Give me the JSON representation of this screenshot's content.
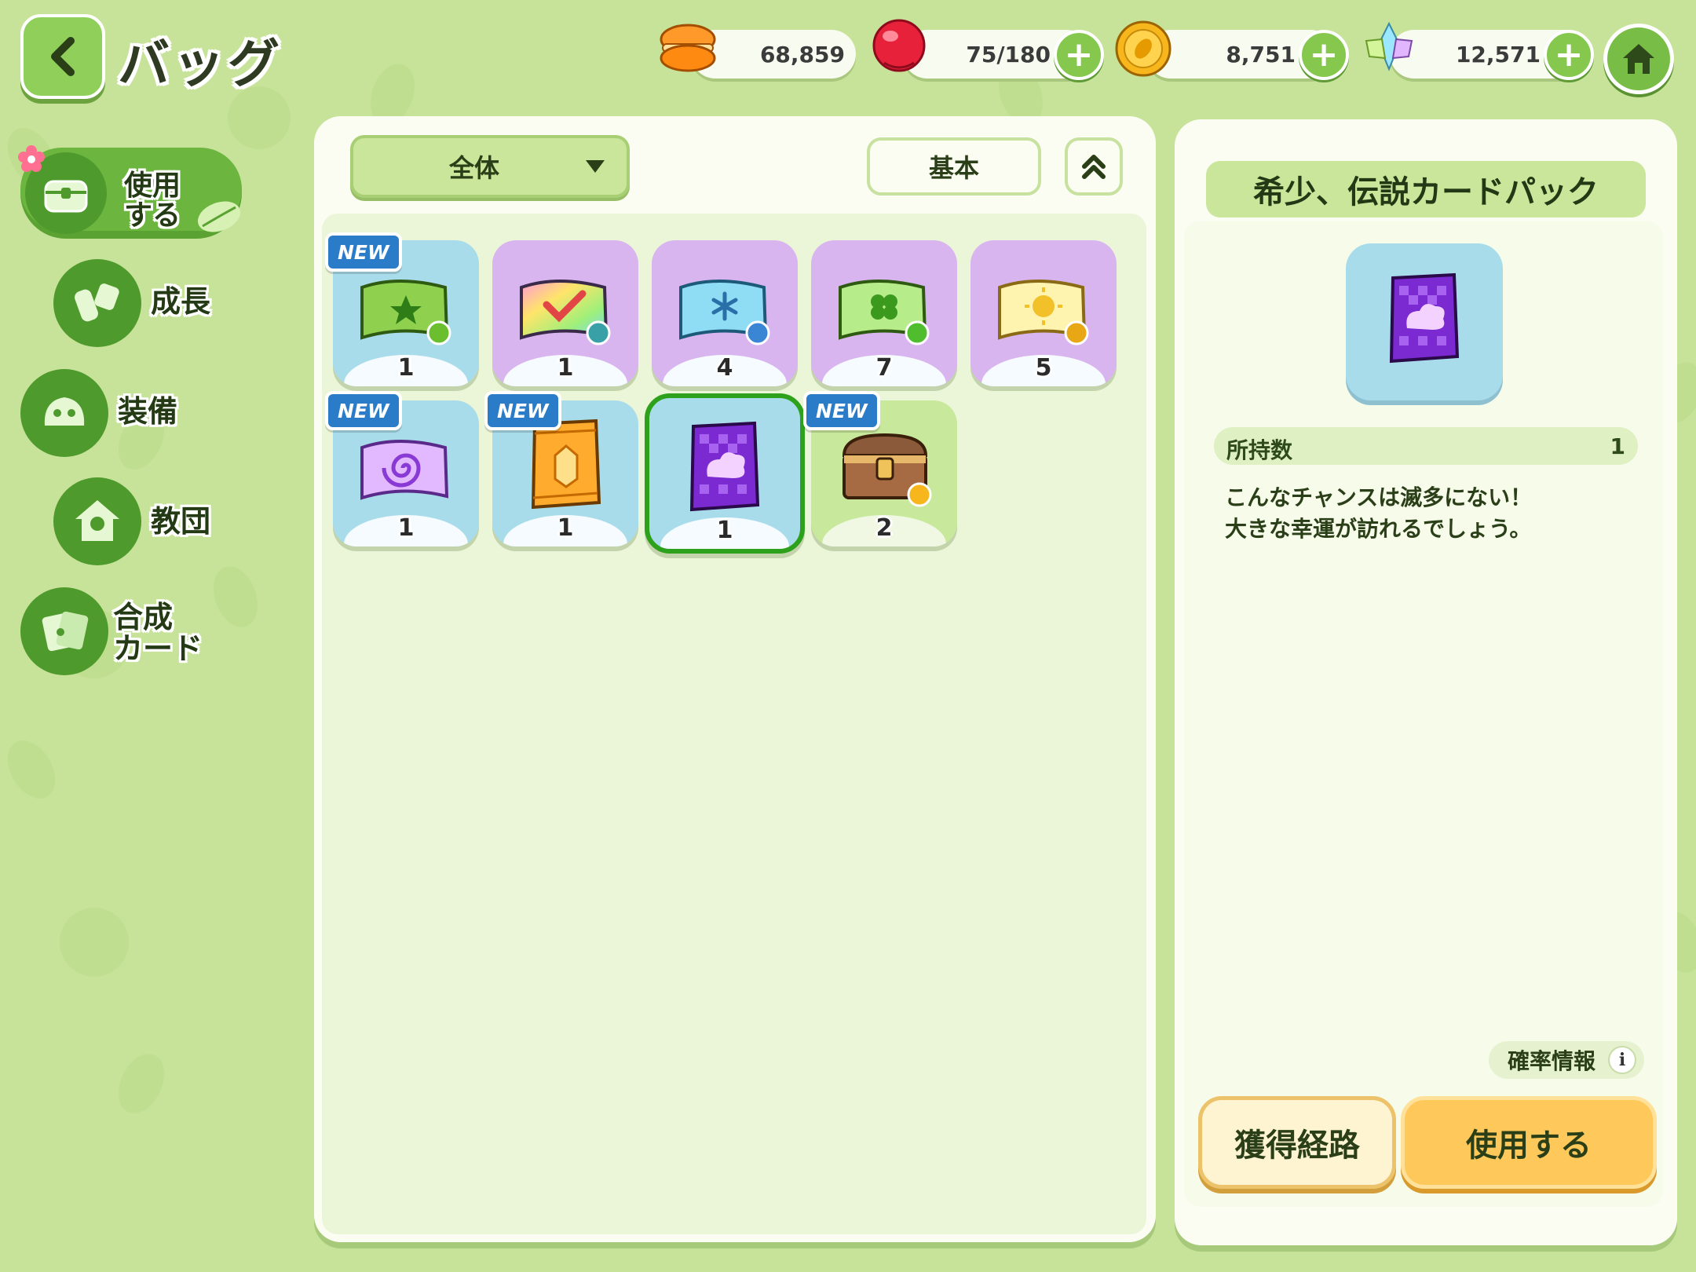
{
  "header": {
    "title": "バッグ",
    "back_icon": "back-arrow-icon",
    "currencies": [
      {
        "icon": "macaron-icon",
        "value": "68,859",
        "has_plus": false
      },
      {
        "icon": "red-candy-icon",
        "value": "75/180",
        "has_plus": true
      },
      {
        "icon": "gold-coin-icon",
        "value": "8,751",
        "has_plus": true
      },
      {
        "icon": "crystal-icon",
        "value": "12,571",
        "has_plus": true
      }
    ],
    "plus_label": "+",
    "home_icon": "home-icon"
  },
  "sidebar": {
    "items": [
      {
        "label": "使用\nする",
        "icon": "chest-icon",
        "active": true
      },
      {
        "label": "成長",
        "icon": "potion-icon",
        "active": false
      },
      {
        "label": "装備",
        "icon": "hat-icon",
        "active": false
      },
      {
        "label": "教団",
        "icon": "house-icon",
        "active": false
      },
      {
        "label": "合成\nカード",
        "icon": "card-icon",
        "active": false
      }
    ]
  },
  "toolbar": {
    "filter_value": "全体",
    "sort_label": "基本"
  },
  "items": [
    {
      "name": "green-star-card",
      "count": "1",
      "new": true,
      "bg": "blue"
    },
    {
      "name": "rainbow-check-card",
      "count": "1",
      "new": false,
      "bg": "purple"
    },
    {
      "name": "blue-snowflake-card",
      "count": "4",
      "new": false,
      "bg": "purple"
    },
    {
      "name": "green-clover-card",
      "count": "7",
      "new": false,
      "bg": "purple"
    },
    {
      "name": "yellow-sun-card",
      "count": "5",
      "new": false,
      "bg": "purple"
    },
    {
      "name": "purple-swirl-card",
      "count": "1",
      "new": true,
      "bg": "blue"
    },
    {
      "name": "orange-card-pack",
      "count": "1",
      "new": true,
      "bg": "blue"
    },
    {
      "name": "purple-card-pack",
      "count": "1",
      "new": false,
      "bg": "blue",
      "selected": true
    },
    {
      "name": "treasure-chest",
      "count": "2",
      "new": true,
      "bg": "green"
    }
  ],
  "new_badge_label": "NEW",
  "detail": {
    "title": "希少、伝説カードパック",
    "owned_label": "所持数",
    "owned_value": "1",
    "description_line1": "こんなチャンスは滅多にない！",
    "description_line2": "大きな幸運が訪れるでしょう。",
    "probability_label": "確率情報",
    "info_glyph": "i",
    "route_button": "獲得経路",
    "use_button": "使用する"
  },
  "colors": {
    "background": "#c7e39a",
    "accent_green": "#4f9a2c",
    "use_button": "#ffc85a",
    "new_badge": "#2a7cc9",
    "selected_border": "#2da11b"
  }
}
